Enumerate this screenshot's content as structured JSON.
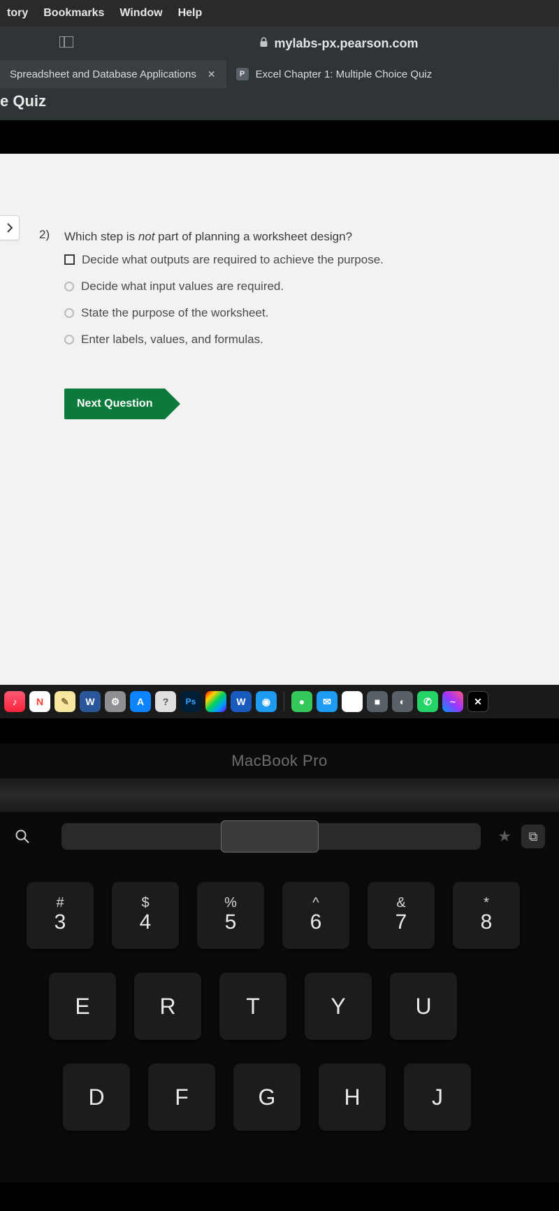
{
  "menubar": {
    "items": [
      "tory",
      "Bookmarks",
      "Window",
      "Help"
    ]
  },
  "browser": {
    "url": "mylabs-px.pearson.com",
    "tabs": [
      {
        "label": "Spreadsheet and Database Applications",
        "closable": true,
        "active": true
      },
      {
        "label": "Excel Chapter 1: Multiple Choice Quiz",
        "favicon": "P",
        "active": false
      }
    ],
    "page_subtitle": "e Quiz"
  },
  "quiz": {
    "question_number": "2)",
    "stem_pre": "Which step is ",
    "stem_em": "not",
    "stem_post": " part of planning a worksheet design?",
    "options": [
      {
        "kind": "checkbox",
        "text": "Decide what outputs are required to achieve the purpose."
      },
      {
        "kind": "radio",
        "text": "Decide what input values are required."
      },
      {
        "kind": "radio",
        "text": "State the purpose of the worksheet."
      },
      {
        "kind": "radio",
        "text": "Enter labels, values, and formulas."
      }
    ],
    "next_label": "Next Question"
  },
  "dock": {
    "icons": [
      {
        "name": "music",
        "label": "♪"
      },
      {
        "name": "news",
        "label": "N"
      },
      {
        "name": "notes",
        "label": "✎"
      },
      {
        "name": "word",
        "label": "W"
      },
      {
        "name": "settings",
        "label": "⚙"
      },
      {
        "name": "appstore",
        "label": "A"
      },
      {
        "name": "help",
        "label": "?"
      },
      {
        "name": "ps",
        "label": "Ps"
      },
      {
        "name": "cc",
        "label": ""
      },
      {
        "name": "word2",
        "label": "W"
      },
      {
        "name": "safari",
        "label": "◉"
      },
      {
        "name": "sep",
        "label": ""
      },
      {
        "name": "messages",
        "label": "●"
      },
      {
        "name": "mail",
        "label": "✉"
      },
      {
        "name": "chrome",
        "label": "◯"
      },
      {
        "name": "generic",
        "label": "■"
      },
      {
        "name": "generic",
        "label": "◐"
      },
      {
        "name": "whatsapp",
        "label": "✆"
      },
      {
        "name": "messenger",
        "label": "~"
      },
      {
        "name": "capcut",
        "label": "✕"
      }
    ]
  },
  "laptop": {
    "label": "MacBook Pro"
  },
  "keyboard": {
    "row1": [
      {
        "sym": "#",
        "main": "3"
      },
      {
        "sym": "$",
        "main": "4"
      },
      {
        "sym": "%",
        "main": "5"
      },
      {
        "sym": "^",
        "main": "6"
      },
      {
        "sym": "&",
        "main": "7"
      },
      {
        "sym": "*",
        "main": "8"
      }
    ],
    "row2": [
      "E",
      "R",
      "T",
      "Y",
      "U"
    ],
    "row3": [
      "D",
      "F",
      "G",
      "H",
      "J"
    ]
  }
}
